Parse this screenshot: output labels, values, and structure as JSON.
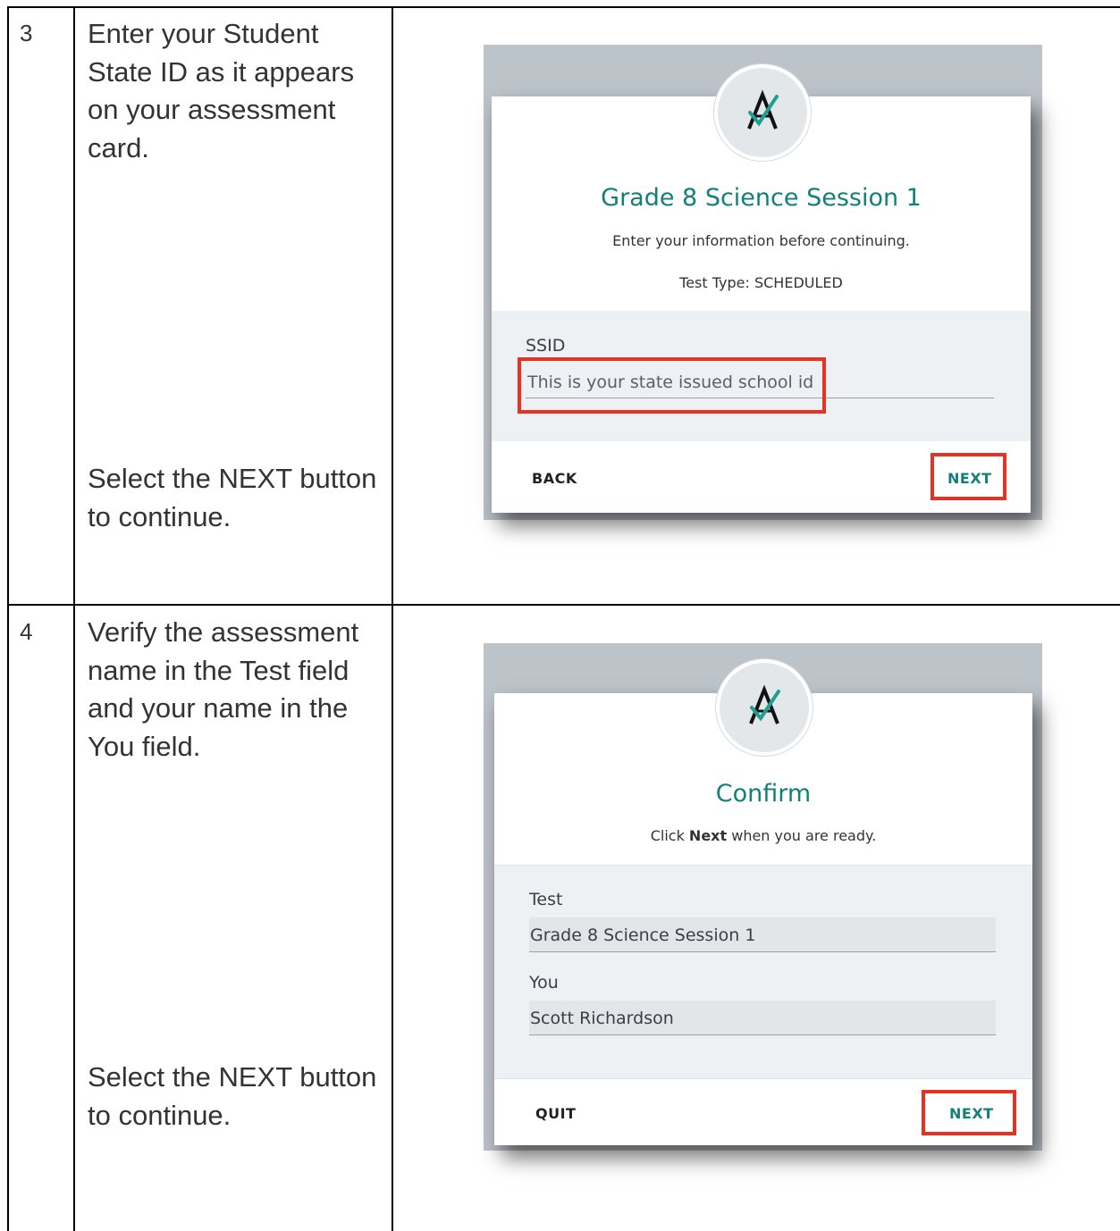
{
  "steps": [
    {
      "number": "3",
      "instruction": "Enter your Student State ID as it appears on your assessment card.",
      "followup": "Select the NEXT button to continue.",
      "screen": {
        "title": "Grade 8 Science Session 1",
        "subtitle": "Enter your information before continuing.",
        "test_type": "Test Type: SCHEDULED",
        "field_label": "SSID",
        "field_placeholder": "This is your state issued school id",
        "back_label": "BACK",
        "next_label": "NEXT"
      }
    },
    {
      "number": "4",
      "instruction": "Verify the assessment name in the Test field and your name in the You field.",
      "followup": "Select the NEXT button to continue.",
      "screen": {
        "title": "Confirm",
        "subtitle_prefix": "Click ",
        "subtitle_bold": "Next",
        "subtitle_suffix": " when you are ready.",
        "test_label": "Test",
        "test_value": "Grade 8 Science Session 1",
        "you_label": "You",
        "you_value": "Scott Richardson",
        "quit_label": "QUIT",
        "next_label": "NEXT"
      }
    }
  ],
  "colors": {
    "accent": "#12807a",
    "highlight": "#e53323",
    "panel_bg": "#bcc3c9"
  },
  "icons": [
    "assessment-logo-icon"
  ]
}
